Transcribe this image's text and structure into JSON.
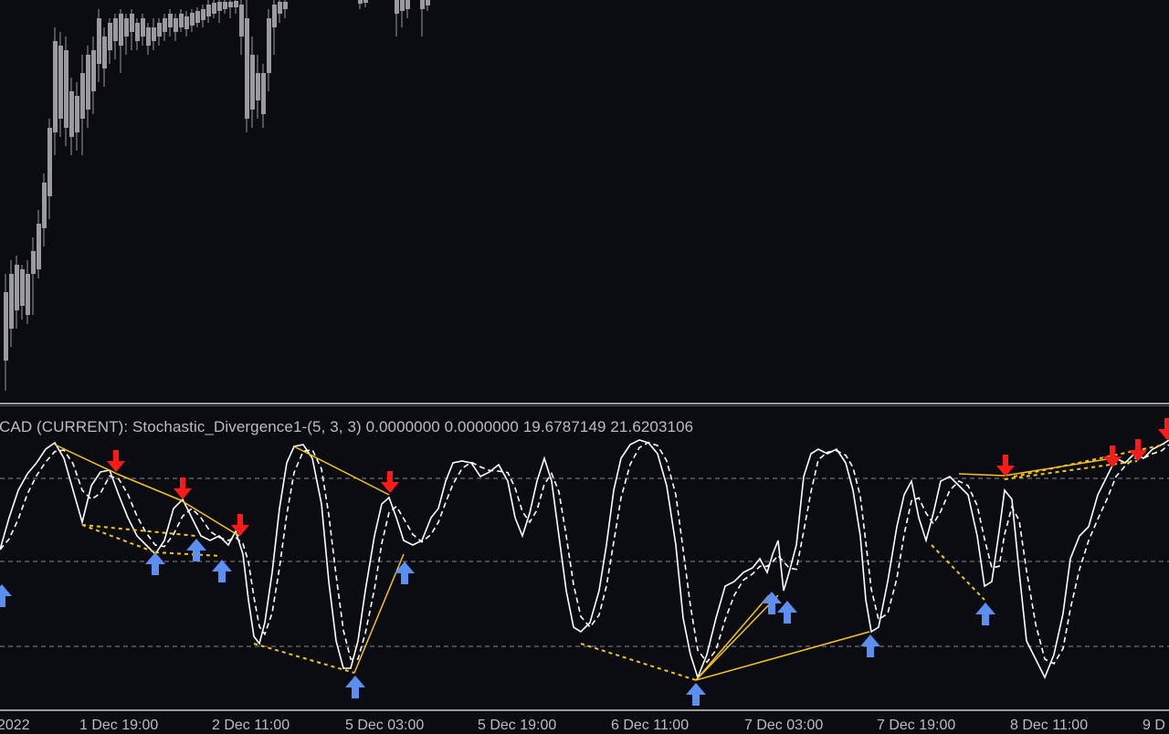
{
  "chart": {
    "indicator_title": "CAD (CURRENT): Stochastic_Divergence1-(5, 3, 3) 0.0000000 0.0000000 19.6787149 21.6203106",
    "colors": {
      "background": "#0b0b12",
      "candle": "#9a9aa0",
      "main_line": "#ffffff",
      "signal_line": "#ffffff",
      "divergence_line": "#f5c518",
      "down_arrow": "#ff1a1a",
      "up_arrow": "#5b8ff0",
      "level_line": "#8a8a8a"
    },
    "levels": [
      80,
      50,
      20
    ],
    "time_axis": {
      "labels": [
        "2022",
        "1 Dec 19:00",
        "2 Dec 11:00",
        "5 Dec 03:00",
        "5 Dec 19:00",
        "6 Dec 11:00",
        "7 Dec 03:00",
        "7 Dec 19:00",
        "8 Dec 11:00",
        "9 D"
      ]
    }
  },
  "chart_data": {
    "type": "line",
    "series": [],
    "ylim": [
      0,
      100
    ],
    "levels": [
      80,
      50,
      20
    ],
    "signals": {
      "sell_arrows": 9,
      "buy_arrows": 12
    }
  }
}
